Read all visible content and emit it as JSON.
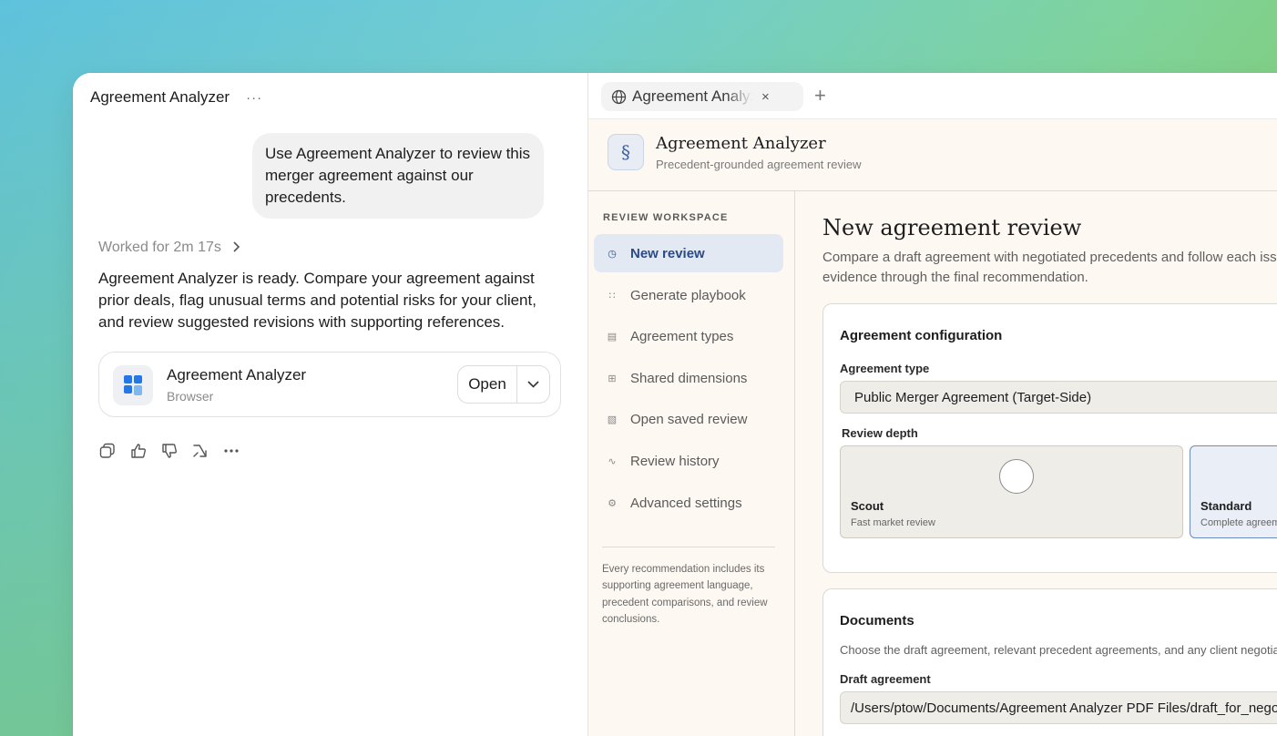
{
  "chat": {
    "title": "Agreement Analyzer",
    "more": "···",
    "user_message": "Use Agreement Analyzer to review this merger agreement against our precedents.",
    "worked_for": "Worked for 2m 17s",
    "assistant_message": "Agreement Analyzer is ready. Compare your agreement against prior deals, flag unusual terms and potential risks for your client, and review suggested revisions with supporting references.",
    "app_card": {
      "name": "Agreement Analyzer",
      "subtitle": "Browser",
      "open_label": "Open"
    },
    "actions": [
      "copy-icon",
      "thumbs-up-icon",
      "thumbs-down-icon",
      "share-icon",
      "more-icon"
    ]
  },
  "browser": {
    "tab_title": "Agreement Analyzer",
    "tab_close": "×",
    "tab_add": "+"
  },
  "app": {
    "icon_glyph": "§",
    "title": "Agreement Analyzer",
    "subtitle": "Precedent-grounded agreement review"
  },
  "sidebar": {
    "heading": "REVIEW WORKSPACE",
    "items": [
      {
        "label": "New review",
        "icon": "◷",
        "active": true
      },
      {
        "label": "Generate playbook",
        "icon": "∷"
      },
      {
        "label": "Agreement types",
        "icon": "▤"
      },
      {
        "label": "Shared dimensions",
        "icon": "⊞"
      },
      {
        "label": "Open saved review",
        "icon": "▧"
      },
      {
        "label": "Review history",
        "icon": "∿"
      },
      {
        "label": "Advanced settings",
        "icon": "⚙"
      }
    ],
    "note": "Every recommendation includes its supporting agreement language, precedent comparisons, and review conclusions."
  },
  "main": {
    "title": "New agreement review",
    "desc_line1": "Compare a draft agreement with negotiated precedents and follow each issue",
    "desc_line2": "evidence through the final recommendation.",
    "config": {
      "title": "Agreement configuration",
      "type_label": "Agreement type",
      "type_value": "Public Merger Agreement (Target-Side)",
      "depth_label": "Review depth",
      "depth_options": [
        {
          "name": "Scout",
          "sub": "Fast market review"
        },
        {
          "name": "Standard",
          "sub": "Complete agreement review"
        }
      ]
    },
    "documents": {
      "title": "Documents",
      "desc": "Choose the draft agreement, relevant precedent agreements, and any client negotiation notes.",
      "draft_label": "Draft agreement",
      "draft_value": "/Users/ptow/Documents/Agreement Analyzer PDF Files/draft_for_negotiation.pdf"
    }
  }
}
